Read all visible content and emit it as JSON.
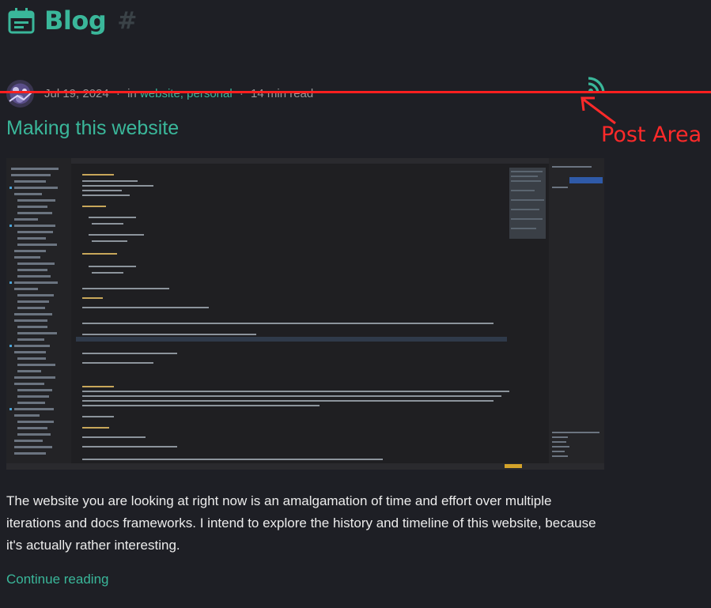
{
  "header": {
    "title": "Blog",
    "anchor": "#"
  },
  "post": {
    "date": "Jul 19, 2024",
    "in_label": "in",
    "categories": [
      "website",
      "personal"
    ],
    "category_separator": ",",
    "reading_time": "14 min read",
    "title": "Making this website",
    "excerpt": "The website you are looking at right now is an amalgamation of time and effort over multiple iterations and docs frameworks. I intend to explore the history and timeline of this website, because it's actually rather interesting.",
    "continue_label": "Continue reading"
  },
  "annotation": {
    "label": "Post Area",
    "color": "#ff1f1f"
  },
  "colors": {
    "accent": "#3ab79a",
    "background": "#1e1f25",
    "text": "#ececec",
    "muted": "#9a9a9a"
  },
  "icons": {
    "blog": "calendar-icon",
    "feed": "rss-icon"
  }
}
